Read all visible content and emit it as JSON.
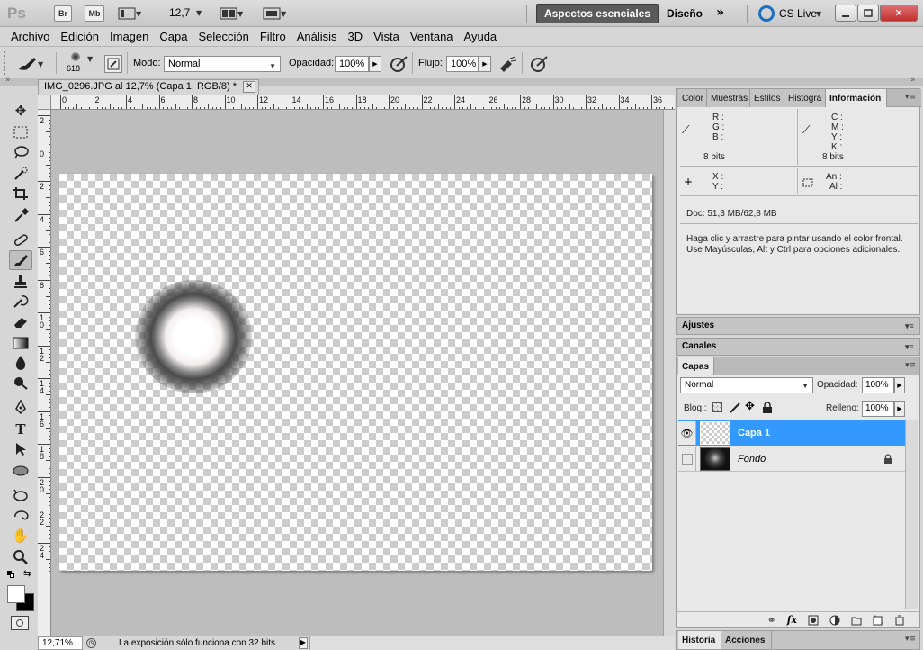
{
  "app": {
    "logo": "Ps",
    "bridge_btn": "Br",
    "minibridge_btn": "Mb",
    "zoom_value": "12,7",
    "workspace_active": "Aspectos esenciales",
    "workspace_other": "Diseño",
    "cs_live": "CS Live"
  },
  "menu": [
    "Archivo",
    "Edición",
    "Imagen",
    "Capa",
    "Selección",
    "Filtro",
    "Análisis",
    "3D",
    "Vista",
    "Ventana",
    "Ayuda"
  ],
  "options": {
    "brush_size": "618",
    "mode_label": "Modo:",
    "mode_value": "Normal",
    "opacity_label": "Opacidad:",
    "opacity_value": "100%",
    "flow_label": "Flujo:",
    "flow_value": "100%"
  },
  "document": {
    "tab_title": "IMG_0296.JPG al 12,7% (Capa 1, RGB/8) *",
    "ruler_top": [
      "0",
      "2",
      "4",
      "6",
      "8",
      "10",
      "12",
      "14",
      "16",
      "18",
      "20",
      "22",
      "24",
      "26",
      "28",
      "30",
      "32",
      "34",
      "36"
    ],
    "ruler_left": [
      "2",
      "0",
      "2",
      "4",
      "6",
      "8",
      "1 0",
      "1 2",
      "1 4",
      "1 6",
      "1 8",
      "2 0",
      "2 2",
      "2 4"
    ],
    "zoom": "12,71%",
    "status_msg": "La exposición sólo funciona con 32 bits"
  },
  "info_panel": {
    "tabs": [
      "Color",
      "Muestras",
      "Estilos",
      "Histogra",
      "Información"
    ],
    "rgb_labels": [
      "R :",
      "G :",
      "B :"
    ],
    "cmyk_labels": [
      "C :",
      "M :",
      "Y :",
      "K :"
    ],
    "bits_left": "8 bits",
    "bits_right": "8 bits",
    "xy_labels": [
      "X :",
      "Y :"
    ],
    "wh_labels": [
      "An :",
      "Al :"
    ],
    "doc_size": "Doc: 51,3 MB/62,8 MB",
    "hint_line1": "Haga clic y arrastre para pintar usando el color frontal.",
    "hint_line2": "Use Mayúsculas, Alt y Ctrl para opciones adicionales."
  },
  "collapsed_panels": {
    "adjustments": "Ajustes",
    "channels": "Canales"
  },
  "layers_panel": {
    "tab": "Capas",
    "blend_mode": "Normal",
    "opacity_label": "Opacidad:",
    "opacity_value": "100%",
    "lock_label": "Bloq.:",
    "fill_label": "Relleno:",
    "fill_value": "100%",
    "layers": [
      {
        "name": "Capa 1",
        "selected": true,
        "visible": true
      },
      {
        "name": "Fondo",
        "selected": false,
        "visible": false,
        "locked": true
      }
    ],
    "fx": "fx"
  },
  "bottom_panel": {
    "tabs": [
      "Historia",
      "Acciones"
    ]
  },
  "colors": {
    "selection_blue": "#3399ff",
    "workspace_btn": "#5b5b5b"
  }
}
